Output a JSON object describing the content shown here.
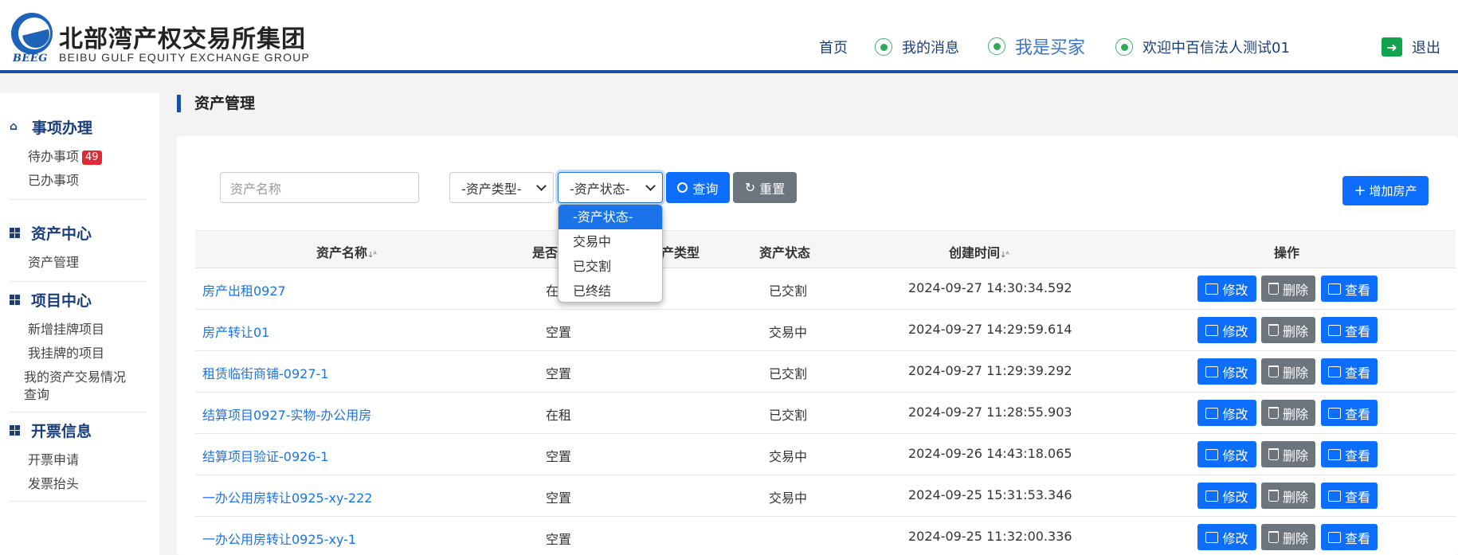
{
  "header": {
    "logo_abbr": "BEEG",
    "brand_cn": "北部湾产权交易所集团",
    "brand_en": "BEIBU GULF EQUITY EXCHANGE GROUP",
    "nav": {
      "home": "首页",
      "messages": "我的消息",
      "buyer": "我是买家",
      "welcome": "欢迎中百信法人测试01",
      "logout": "退出"
    }
  },
  "sidebar": {
    "groups": [
      {
        "title": "事项办理",
        "icon": "home-icon",
        "items": [
          {
            "label": "待办事项",
            "badge": "49"
          },
          {
            "label": "已办事项"
          }
        ]
      },
      {
        "title": "资产中心",
        "icon": "grid-icon",
        "items": [
          {
            "label": "资产管理"
          }
        ]
      },
      {
        "title": "项目中心",
        "icon": "grid-icon",
        "items": [
          {
            "label": "新增挂牌项目"
          },
          {
            "label": "我挂牌的项目"
          },
          {
            "label": "我的资产交易情况查询"
          }
        ]
      },
      {
        "title": "开票信息",
        "icon": "grid-icon",
        "items": [
          {
            "label": "开票申请"
          },
          {
            "label": "发票抬头"
          }
        ]
      }
    ]
  },
  "page_title": "资产管理",
  "filters": {
    "search_placeholder": "资产名称",
    "type_select": "-资产类型-",
    "status_select": "-资产状态-",
    "query_button": "查询",
    "reset_button": "重置",
    "add_button": "增加房产"
  },
  "status_dropdown": {
    "options": [
      "-资产状态-",
      "交易中",
      "已交割",
      "已终结"
    ],
    "selected": "-资产状态-"
  },
  "table": {
    "headers": {
      "name": "资产名称",
      "occupied": "是否",
      "type": "产类型",
      "status": "资产状态",
      "created": "创建时间",
      "ops": "操作"
    },
    "rows": [
      {
        "name": "房产出租0927",
        "occupied": "在",
        "status": "已交割",
        "created": "2024-09-27 14:30:34.592"
      },
      {
        "name": "房产转让01",
        "occupied": "空置",
        "status": "交易中",
        "created": "2024-09-27 14:29:59.614"
      },
      {
        "name": "租赁临街商铺-0927-1",
        "occupied": "空置",
        "status": "已交割",
        "created": "2024-09-27 11:29:39.292"
      },
      {
        "name": "结算项目0927-实物-办公用房",
        "occupied": "在租",
        "status": "已交割",
        "created": "2024-09-27 11:28:55.903"
      },
      {
        "name": "结算项目验证-0926-1",
        "occupied": "空置",
        "status": "交易中",
        "created": "2024-09-26 14:43:18.065"
      },
      {
        "name": "一办公用房转让0925-xy-222",
        "occupied": "空置",
        "status": "交易中",
        "created": "2024-09-25 15:31:53.346"
      },
      {
        "name": "一办公用房转让0925-xy-1",
        "occupied": "空置",
        "status": "",
        "created": "2024-09-25 11:32:00.336"
      }
    ],
    "op_labels": {
      "edit": "修改",
      "delete": "删除",
      "view": "查看"
    }
  },
  "colors": {
    "primary": "#0d6efd",
    "secondary": "#6c757d",
    "brand": "#1a4ea3",
    "badge": "#e02b37"
  }
}
